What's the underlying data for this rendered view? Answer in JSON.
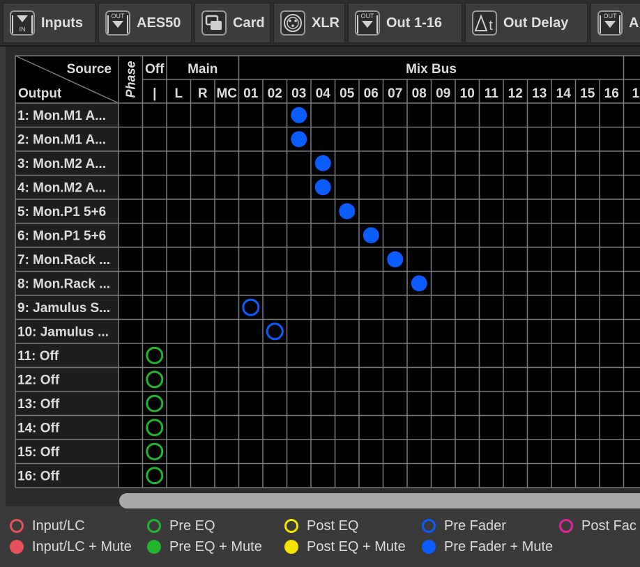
{
  "tabs": [
    {
      "label": "Inputs",
      "icon": "input-in-icon",
      "icon_text": "IN"
    },
    {
      "label": "AES50",
      "icon": "output-out-icon",
      "icon_text": "OUT"
    },
    {
      "label": "Card",
      "icon": "card-icon",
      "icon_text": ""
    },
    {
      "label": "XLR",
      "icon": "xlr-connector-icon",
      "icon_text": ""
    },
    {
      "label": "Out 1-16",
      "icon": "output-out-icon",
      "icon_text": "OUT"
    },
    {
      "label": "Out Delay",
      "icon": "delta-t-icon",
      "icon_text": "Δt"
    },
    {
      "label": "A",
      "icon": "output-out-icon",
      "icon_text": "OUT"
    }
  ],
  "matrix": {
    "corner_source": "Source",
    "corner_output": "Output",
    "phase_label": "Phase",
    "off_label": "Off",
    "off_sub": "|",
    "main_label": "Main",
    "main_cols": [
      "L",
      "R",
      "MC"
    ],
    "mixbus_label": "Mix Bus",
    "mixbus_cols": [
      "01",
      "02",
      "03",
      "04",
      "05",
      "06",
      "07",
      "08",
      "09",
      "10",
      "11",
      "12",
      "13",
      "14",
      "15",
      "16",
      "1"
    ],
    "rows": [
      "1: Mon.M1 A...",
      "2: Mon.M1 A...",
      "3: Mon.M2 A...",
      "4: Mon.M2 A...",
      "5: Mon.P1 5+6",
      "6: Mon.P1 5+6",
      "7: Mon.Rack ...",
      "8: Mon.Rack ...",
      "9: Jamulus S...",
      "10: Jamulus ...",
      "11: Off",
      "12: Off",
      "13: Off",
      "14: Off",
      "15: Off",
      "16: Off"
    ],
    "routes": [
      {
        "row": 0,
        "col": "03",
        "type": "pre_fader_mute"
      },
      {
        "row": 1,
        "col": "03",
        "type": "pre_fader_mute"
      },
      {
        "row": 2,
        "col": "04",
        "type": "pre_fader_mute"
      },
      {
        "row": 3,
        "col": "04",
        "type": "pre_fader_mute"
      },
      {
        "row": 4,
        "col": "05",
        "type": "pre_fader_mute"
      },
      {
        "row": 5,
        "col": "06",
        "type": "pre_fader_mute"
      },
      {
        "row": 6,
        "col": "07",
        "type": "pre_fader_mute"
      },
      {
        "row": 7,
        "col": "08",
        "type": "pre_fader_mute"
      },
      {
        "row": 8,
        "col": "01",
        "type": "pre_fader"
      },
      {
        "row": 9,
        "col": "02",
        "type": "pre_fader"
      },
      {
        "row": 10,
        "col": "off",
        "type": "pre_eq"
      },
      {
        "row": 11,
        "col": "off",
        "type": "pre_eq"
      },
      {
        "row": 12,
        "col": "off",
        "type": "pre_eq"
      },
      {
        "row": 13,
        "col": "off",
        "type": "pre_eq"
      },
      {
        "row": 14,
        "col": "off",
        "type": "pre_eq"
      },
      {
        "row": 15,
        "col": "off",
        "type": "pre_eq"
      }
    ]
  },
  "legend": [
    {
      "label": "Input/LC",
      "type": "input_lc"
    },
    {
      "label": "Pre EQ",
      "type": "pre_eq"
    },
    {
      "label": "Post EQ",
      "type": "post_eq"
    },
    {
      "label": "Pre Fader",
      "type": "pre_fader"
    },
    {
      "label": "Post Fac",
      "type": "post_fader"
    },
    {
      "label": "Input/LC + Mute",
      "type": "input_lc_mute"
    },
    {
      "label": "Pre EQ + Mute",
      "type": "pre_eq_mute"
    },
    {
      "label": "Post EQ + Mute",
      "type": "post_eq_mute"
    },
    {
      "label": "Pre Fader + Mute",
      "type": "pre_fader_mute"
    }
  ],
  "colors": {
    "input_lc": "#e8505b",
    "pre_eq": "#22b530",
    "post_eq": "#f5e400",
    "pre_fader": "#0a5cff",
    "post_fader": "#e0239a"
  }
}
